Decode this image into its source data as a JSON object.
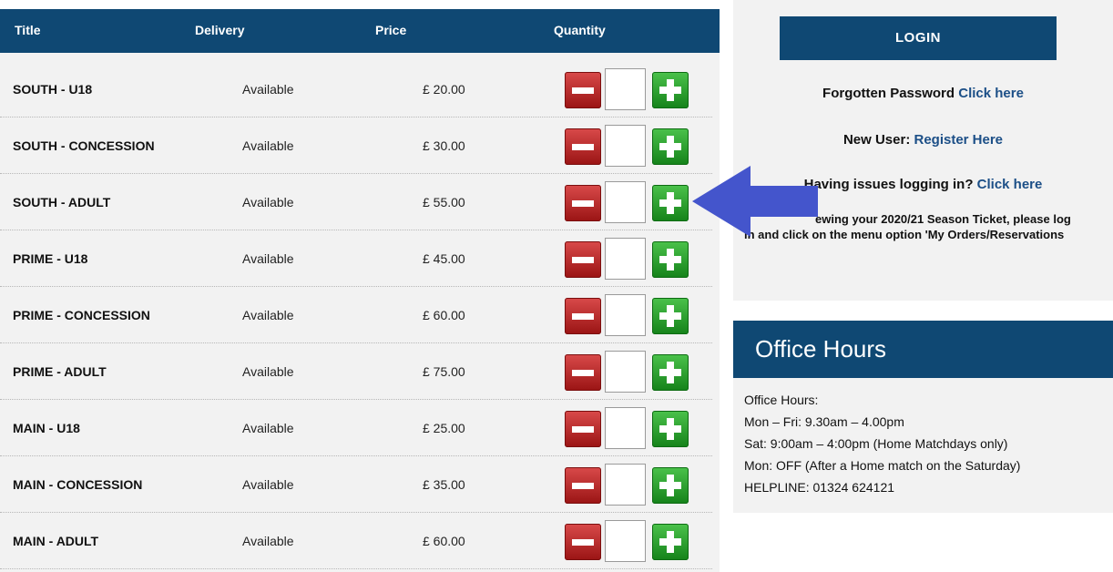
{
  "table": {
    "headers": {
      "title": "Title",
      "delivery": "Delivery",
      "price": "Price",
      "quantity": "Quantity"
    },
    "rows": [
      {
        "title": "SOUTH - U18",
        "delivery": "Available",
        "price": "£ 20.00",
        "quantity": ""
      },
      {
        "title": "SOUTH - CONCESSION",
        "delivery": "Available",
        "price": "£ 30.00",
        "quantity": ""
      },
      {
        "title": "SOUTH - ADULT",
        "delivery": "Available",
        "price": "£ 55.00",
        "quantity": ""
      },
      {
        "title": "PRIME - U18",
        "delivery": "Available",
        "price": "£ 45.00",
        "quantity": ""
      },
      {
        "title": "PRIME - CONCESSION",
        "delivery": "Available",
        "price": "£ 60.00",
        "quantity": ""
      },
      {
        "title": "PRIME - ADULT",
        "delivery": "Available",
        "price": "£ 75.00",
        "quantity": ""
      },
      {
        "title": "MAIN - U18",
        "delivery": "Available",
        "price": "£ 25.00",
        "quantity": ""
      },
      {
        "title": "MAIN - CONCESSION",
        "delivery": "Available",
        "price": "£ 35.00",
        "quantity": ""
      },
      {
        "title": "MAIN - ADULT",
        "delivery": "Available",
        "price": "£ 60.00",
        "quantity": ""
      }
    ]
  },
  "login": {
    "button_label": "LOGIN",
    "forgot_lead": "Forgotten Password",
    "forgot_link": "Click here",
    "new_user_lead": "New User:",
    "new_user_link": "Register Here",
    "issues_lead": "Having issues logging in?",
    "issues_link": "Click here",
    "note_line1": "ewing your 2020/21 Season Ticket, please log",
    "note_line2": "in and click on the menu option 'My Orders/Reservations"
  },
  "office": {
    "heading": "Office Hours",
    "lines": [
      "Office Hours:",
      "Mon – Fri: 9.30am – 4.00pm",
      "Sat: 9:00am – 4:00pm (Home Matchdays only)",
      "Mon: OFF (After a Home match on the Saturday)",
      "HELPLINE: 01324 624121"
    ]
  },
  "colors": {
    "header_navy": "#0f4873",
    "link_blue": "#1c4f87",
    "minus_red": "#b42020",
    "plus_green": "#2ea32f",
    "arrow_blue": "#4455cc"
  },
  "icons": {
    "decrease": "minus-icon",
    "increase": "plus-icon",
    "pointer": "left-arrow-icon"
  }
}
